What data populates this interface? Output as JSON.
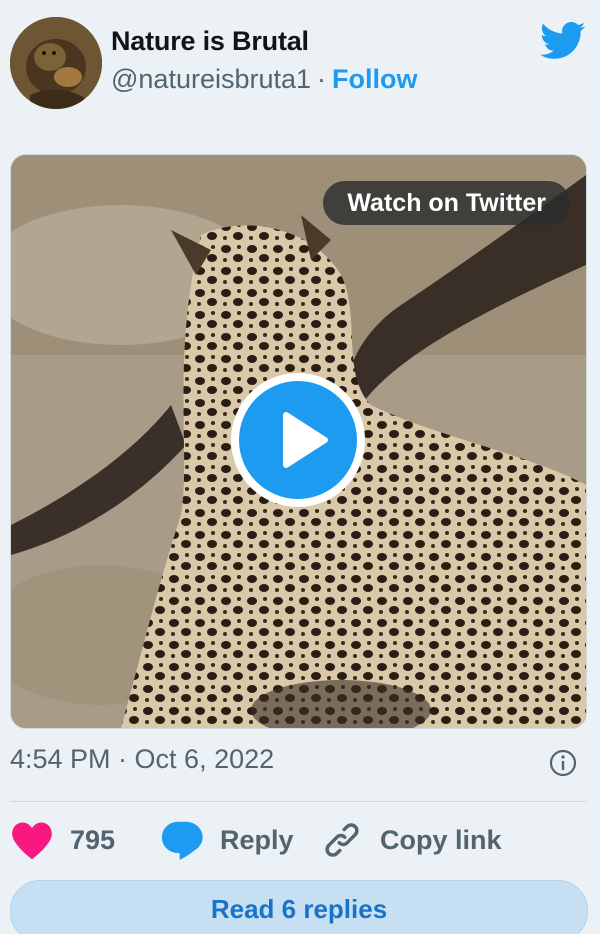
{
  "tweet": {
    "author": {
      "name": "Nature is Brutal",
      "handle": "@natureisbruta1",
      "separator": "·",
      "follow_label": "Follow"
    },
    "media": {
      "watch_label": "Watch on Twitter"
    },
    "timestamp": "4:54 PM · Oct 6, 2022",
    "actions": {
      "like_count": "795",
      "reply_label": "Reply",
      "copy_link_label": "Copy link"
    },
    "read_replies_label": "Read 6 replies"
  },
  "colors": {
    "accent": "#1d9bf0",
    "like": "#f91880",
    "text_secondary": "#536471",
    "background": "#ebf1f5"
  },
  "icons": {
    "brand": "twitter-bird-icon",
    "info": "info-icon",
    "like": "heart-icon",
    "reply": "speech-bubble-icon",
    "copy": "link-icon",
    "play": "play-icon"
  }
}
